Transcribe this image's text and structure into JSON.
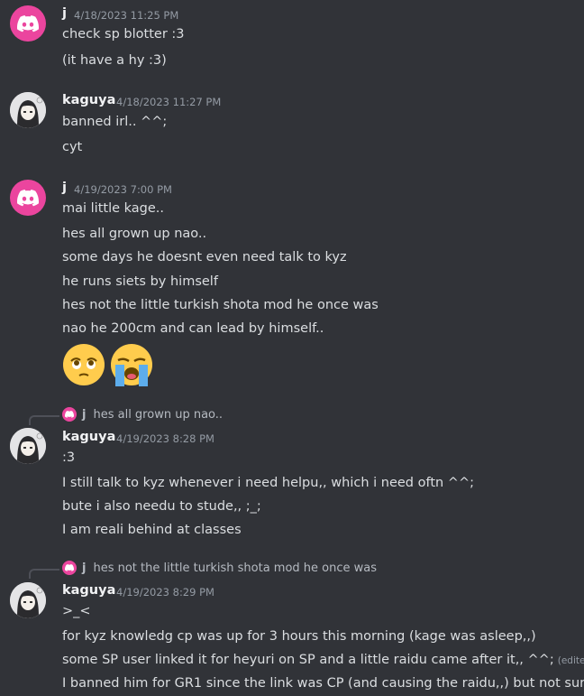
{
  "messages": [
    {
      "author": "j",
      "timestamp": "4/18/2023 11:25 PM",
      "lines": [
        "check sp blotter :3",
        "(it have a hy :3)"
      ]
    },
    {
      "author": "kaguya",
      "timestamp": "4/18/2023 11:27 PM",
      "lines": [
        "banned irl.. ^^;",
        "cyt"
      ]
    },
    {
      "author": "j",
      "timestamp": "4/19/2023 7:00 PM",
      "lines": [
        "mai little kage..",
        "hes all grown up nao..",
        "some days he doesnt even need talk to kyz",
        "he runs siets by himself",
        "hes not the little turkish shota mod he once was",
        "nao he 200cm and can lead by himself.."
      ],
      "emojis": [
        "face-holding-back-tears-emoji",
        "loudly-crying-face-emoji"
      ]
    },
    {
      "reply_to": {
        "author": "j",
        "text": "hes all grown up nao.."
      },
      "author": "kaguya",
      "timestamp": "4/19/2023 8:28 PM",
      "lines": [
        ":3",
        "I still talk to kyz whenever i need helpu,, which i need oftn ^^;",
        "bute i also needu to stude,, ;_;",
        "I am reali behind at classes"
      ]
    },
    {
      "reply_to": {
        "author": "j",
        "text": "hes not the little turkish shota mod he once was"
      },
      "author": "kaguya",
      "timestamp": "4/19/2023 8:29 PM",
      "lines": [
        ">_<",
        "for kyz knowledg cp was up for 3 hours this morning (kage was asleep,,)",
        "some SP user linked it for heyuri on SP and a little raidu came after it,, ^^;",
        "I banned him for GR1 since the link was CP (and causing the raidu,,) but not sur"
      ],
      "edited_label": "(edited)"
    }
  ],
  "colors": {
    "background": "#313338",
    "discord_avatar": "#eb459e",
    "username": "#f2f3f5",
    "timestamp": "#949ba4",
    "text": "#dbdee1"
  }
}
